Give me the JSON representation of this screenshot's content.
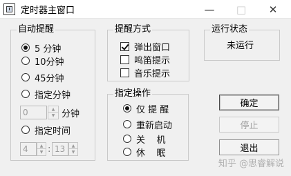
{
  "window": {
    "title": "定时器主窗口",
    "minimize": "—",
    "maximize": "□",
    "close": "✕"
  },
  "auto_reminder": {
    "title": "自动提醒",
    "options": [
      "5 分钟",
      "10分钟",
      "45分钟",
      "指定分钟",
      "指定时间"
    ],
    "selected": "5 分钟",
    "minutes_value": "0",
    "minutes_unit": "分钟",
    "hour_value": "4",
    "time_separator": ":",
    "minute_value": "13"
  },
  "reminder_mode": {
    "title": "提醒方式",
    "options": [
      {
        "label": "弹出窗口",
        "checked": true
      },
      {
        "label": "鸣笛提示",
        "checked": false
      },
      {
        "label": "音乐提示",
        "checked": false
      }
    ]
  },
  "specified_action": {
    "title": "指定操作",
    "options": [
      "仅 提 醒",
      "重新启动",
      "关    机",
      "休    眠"
    ],
    "selected": "仅 提 醒"
  },
  "run_status": {
    "title": "运行状态",
    "value": "未运行"
  },
  "buttons": {
    "ok": "确定",
    "stop": "停止",
    "exit": "退出"
  },
  "watermark": "知乎 @思睿解说"
}
